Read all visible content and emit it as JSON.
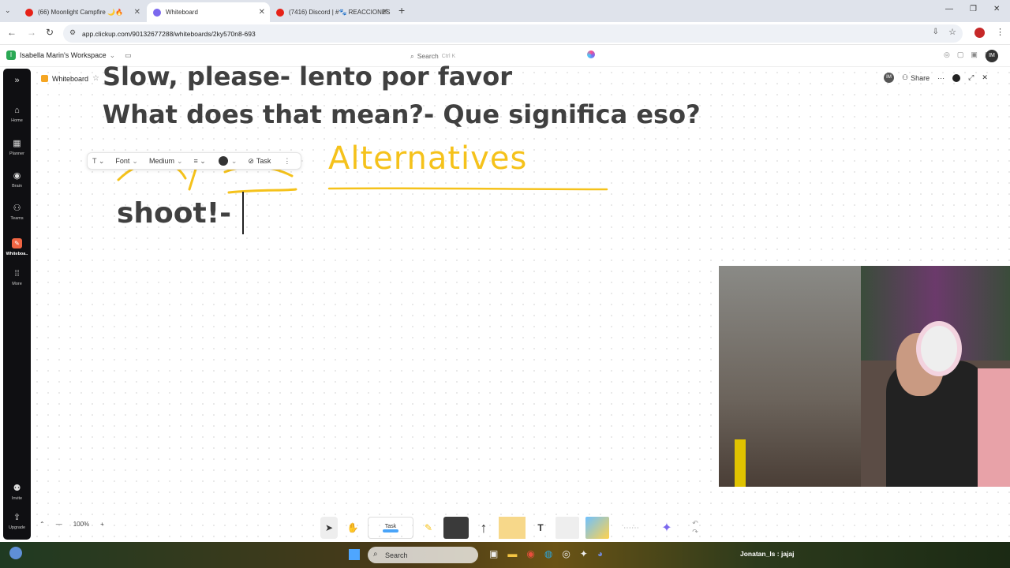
{
  "browser": {
    "tabs": [
      {
        "title": "(66) Moonlight Campfire 🌙🔥",
        "favicon_color": "#e62117",
        "active": false
      },
      {
        "title": "Whiteboard",
        "favicon_color": "#7b68ee",
        "active": true
      },
      {
        "title": "(7416) Discord | #🐾 REACCIONES",
        "favicon_color": "#e62117",
        "active": false
      }
    ],
    "url": "app.clickup.com/90132677288/whiteboards/2ky570n8-693"
  },
  "clickup": {
    "workspace": "Isabella Marin's Workspace",
    "workspace_initial": "I",
    "search_label": "Search",
    "search_shortcut": "Ctrl K",
    "avatar": "IM"
  },
  "sidebar": {
    "items": [
      {
        "label": "Home",
        "icon": "home-icon"
      },
      {
        "label": "Planner",
        "icon": "calendar-icon"
      },
      {
        "label": "Brain",
        "icon": "brain-icon"
      },
      {
        "label": "Teams",
        "icon": "teams-icon"
      },
      {
        "label": "Whiteboa..",
        "icon": "whiteboard-icon"
      },
      {
        "label": "More",
        "icon": "grid-icon"
      }
    ],
    "bottom": [
      {
        "label": "Invite",
        "icon": "invite-icon"
      },
      {
        "label": "Upgrade",
        "icon": "rocket-icon"
      }
    ]
  },
  "whiteboard": {
    "title": "Whiteboard",
    "share_label": "Share",
    "avatar": "IM",
    "line1": "Slow, please-  lento por favor",
    "line2": "What does that mean?- Que significa eso?",
    "alternatives": "Alternatives",
    "line3": "shoot!-",
    "alt_color": "#f5c21b",
    "ink_color": "#404040"
  },
  "text_toolbar": {
    "font_label": "Font",
    "size_label": "Medium",
    "task_label": "Task"
  },
  "bottom": {
    "zoom": "100%",
    "task_label": "Task"
  },
  "taskbar": {
    "search_label": "Search",
    "user_label": "Jonatan_ls : jajaj"
  }
}
